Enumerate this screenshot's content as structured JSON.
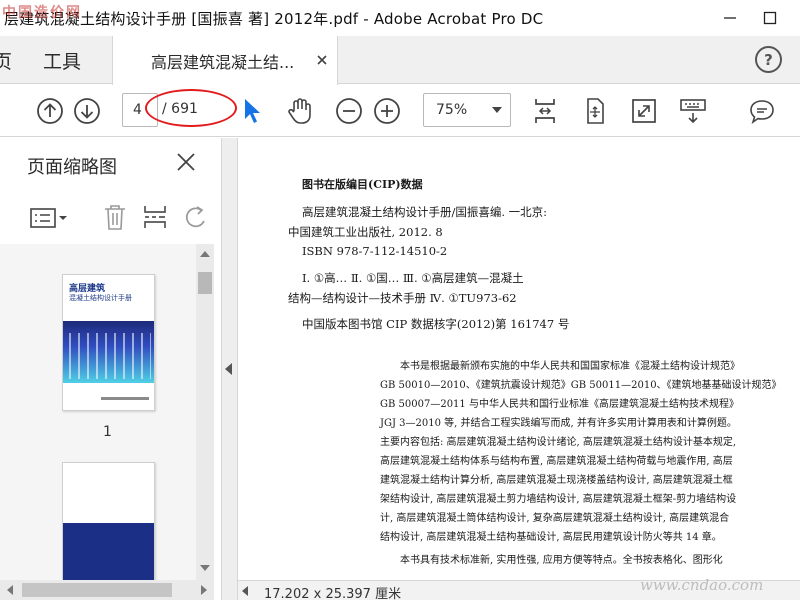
{
  "window": {
    "title": "层建筑混凝土结构设计手册 [国振喜 著] 2012年.pdf - Adobe Acrobat Pro DC"
  },
  "tabs": [
    {
      "label": "页"
    },
    {
      "label": "工具"
    },
    {
      "label": "高层建筑混凝土结..."
    }
  ],
  "toolbar": {
    "page_current": "4",
    "page_total": "/ 691",
    "zoom": "75%"
  },
  "left_panel": {
    "title": "页面缩略图",
    "thumb1": {
      "title": "高层建筑",
      "subtitle": "混凝土结构设计手册",
      "page_number": "1"
    }
  },
  "document": {
    "cip_title": "图书在版编目(CIP)数据",
    "cip_lines": [
      "高层建筑混凝土结构设计手册/国振喜编. 一北京:",
      "中国建筑工业出版社, 2012. 8",
      "ISBN 978-7-112-14510-2",
      "Ⅰ. ①高… Ⅱ. ①国… Ⅲ. ①高层建筑—混凝土",
      "结构—结构设计—技术手册 Ⅳ. ①TU973-62",
      "中国版本图书馆 CIP 数据核字(2012)第 161747 号"
    ],
    "para_lines": [
      "本书是根据最新颁布实施的中华人民共和国国家标准《混凝土结构设计规范》",
      "GB 50010—2010、《建筑抗震设计规范》GB 50011—2010、《建筑地基基础设计规范》",
      "GB 50007—2011 与中华人民共和国行业标准《高层建筑混凝土结构技术规程》",
      "JGJ 3—2010 等, 并结合工程实践编写而成, 并有许多实用计算用表和计算例题。",
      "主要内容包括: 高层建筑混凝土结构设计绪论, 高层建筑混凝土结构设计基本规定,",
      "高层建筑混凝土结构体系与结构布置, 高层建筑混凝土结构荷载与地震作用, 高层",
      "建筑混凝土结构计算分析, 高层建筑混凝土现浇楼盖结构设计, 高层建筑混凝土框",
      "架结构设计, 高层建筑混凝土剪力墙结构设计, 高层建筑混凝土框架-剪力墙结构设",
      "计, 高层建筑混凝土筒体结构设计, 复杂高层建筑混凝土结构设计, 高层建筑混合",
      "结构设计, 高层建筑混凝土结构基础设计, 高层民用建筑设计防火等共 14 章。",
      "本书具有技术标准新, 实用性强, 应用方便等特点。全书按表格化、图形化"
    ]
  },
  "status": {
    "dimensions": "17.202 x 25.397 厘米"
  },
  "watermarks": {
    "top_left": "中国造价网",
    "bottom_right": "www.cndao.com"
  }
}
